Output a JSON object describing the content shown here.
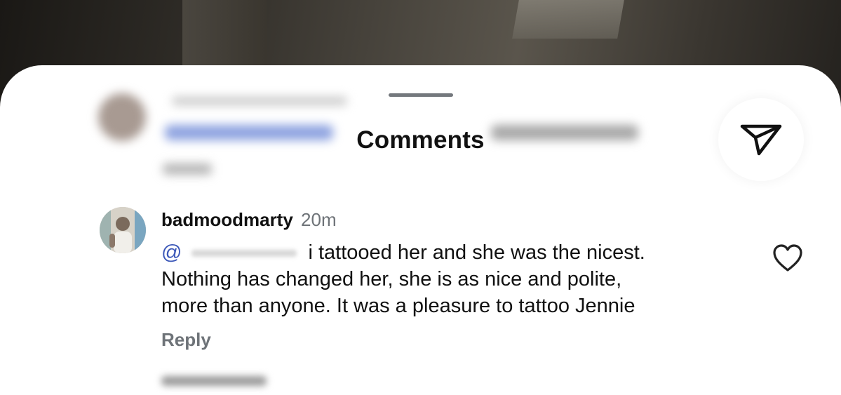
{
  "sheet": {
    "title": "Comments"
  },
  "comment": {
    "username": "badmoodmarty",
    "time": "20m",
    "mention_prefix": "@",
    "line1": "i tattooed her and she was the nicest.",
    "line2": "Nothing has changed her, she is as nice and polite,",
    "line3": "more than anyone. It was a pleasure to tattoo Jennie",
    "reply_label": "Reply"
  },
  "icons": {
    "share": "send-icon",
    "like": "heart-icon",
    "avatar": "avatar"
  }
}
